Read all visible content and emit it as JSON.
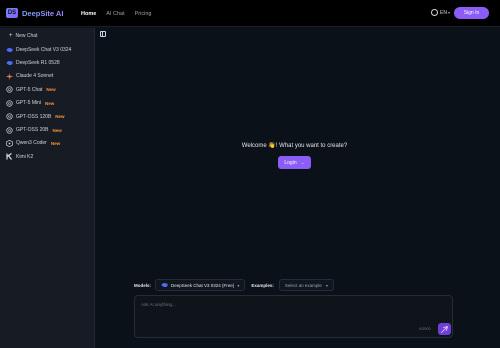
{
  "app": {
    "logo_mark": "DS",
    "title": "DeepSite AI"
  },
  "nav": {
    "items": [
      "Home",
      "AI Chat",
      "Pricing"
    ],
    "active": "Home"
  },
  "header": {
    "language": "EN",
    "signin_label": "Sign In"
  },
  "sidebar": {
    "new_chat_label": "New Chat",
    "items": [
      {
        "label": "DeepSeek Chat V3 0324",
        "icon": "deepseek-whale-icon",
        "badge": ""
      },
      {
        "label": "DeepSeek R1 0528",
        "icon": "deepseek-whale-icon",
        "badge": ""
      },
      {
        "label": "Claude 4 Sonnet",
        "icon": "claude-star-icon",
        "badge": ""
      },
      {
        "label": "GPT-5 Chat",
        "icon": "openai-icon",
        "badge": "New"
      },
      {
        "label": "GPT-5 Mini",
        "icon": "openai-icon",
        "badge": "New"
      },
      {
        "label": "GPT-OSS 120B",
        "icon": "openai-icon",
        "badge": "New"
      },
      {
        "label": "GPT-OSS 20B",
        "icon": "openai-icon",
        "badge": "New"
      },
      {
        "label": "Qwen3 Coder",
        "icon": "qwen-icon",
        "badge": "New"
      },
      {
        "label": "Kimi K2",
        "icon": "kimi-icon",
        "badge": ""
      }
    ]
  },
  "main": {
    "welcome_text": "Welcome 👋! What you want to create?",
    "login_label": "Login",
    "models_label": "Models:",
    "model_selected": "DeepSeek Chat V3 0324 (Free)",
    "examples_label": "Examples:",
    "examples_placeholder": "Select an example",
    "input_placeholder": "Ask AI anything...",
    "char_counter": "0/2500"
  },
  "colors": {
    "accent": "#8b5cf6",
    "background": "#0b1119",
    "sidebar": "#171c24",
    "new_badge": "#fb923c"
  }
}
